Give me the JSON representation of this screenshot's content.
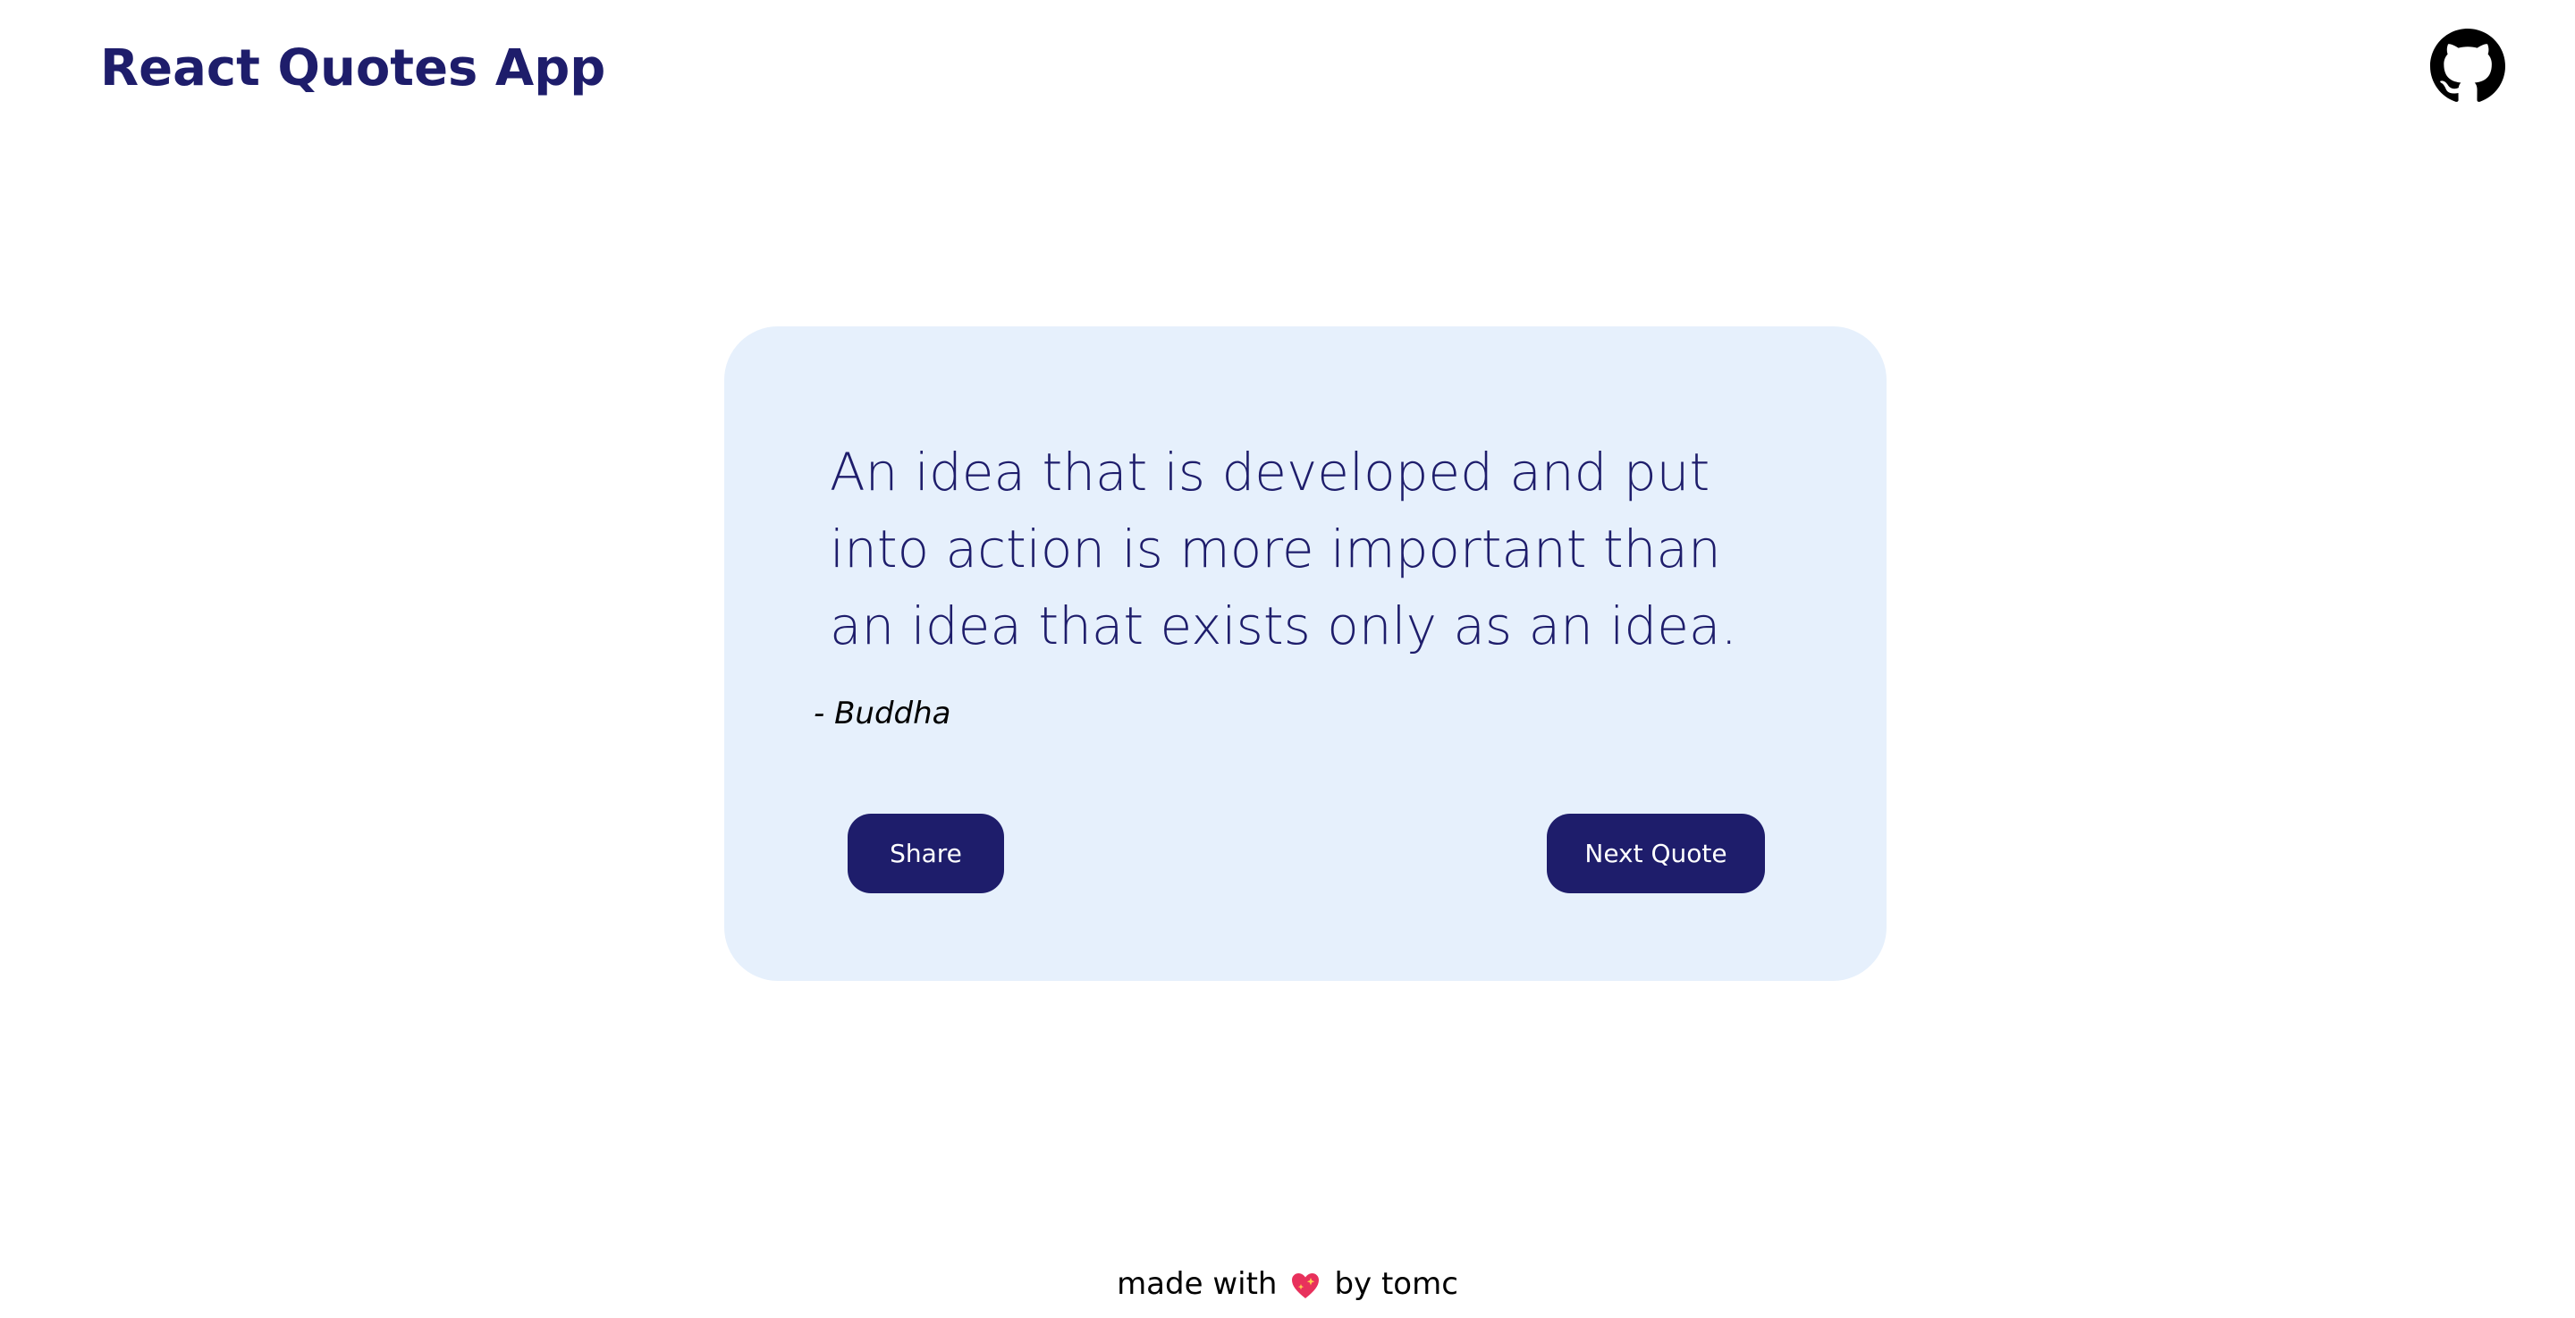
{
  "header": {
    "title": "React Quotes App",
    "github_icon": "github-icon"
  },
  "quote": {
    "text": "An idea that is developed and put into action is more important than an idea that exists only as an idea.",
    "author": "- Buddha"
  },
  "actions": {
    "share_label": "Share",
    "next_label": "Next Quote"
  },
  "footer": {
    "prefix": "made with",
    "heart_icon": "sparkling-heart-icon",
    "suffix": "by tomc"
  },
  "colors": {
    "primary": "#1e1d6b",
    "card_background": "#e6f0fc",
    "heart": "#e8315c"
  }
}
